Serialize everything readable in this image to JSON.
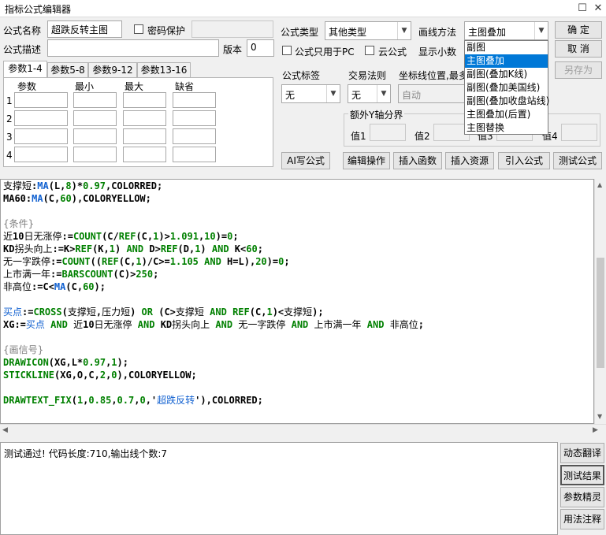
{
  "window": {
    "title": "指标公式编辑器",
    "restore_glyph": "☐",
    "close_glyph": "✕"
  },
  "form": {
    "name_label": "公式名称",
    "name_value": "超跌反转主图",
    "password_label": "密码保护",
    "desc_label": "公式描述",
    "version_label": "版本",
    "version_value": "0",
    "type_label": "公式类型",
    "type_value": "其他类型",
    "draw_label": "画线方法",
    "draw_value": "主图叠加",
    "pc_only_label": "公式只用于PC",
    "cloud_label": "云公式",
    "decimals_label": "显示小数",
    "tag_label": "公式标签",
    "tag_value": "无",
    "trade_label": "交易法则",
    "trade_value": "无",
    "axis_label": "坐标线位置,最多",
    "axis_value": "自动",
    "y_axis_group": "额外Y轴分界",
    "y_values": [
      "值1",
      "值2",
      "值3",
      "值4"
    ]
  },
  "buttons": {
    "ok": "确 定",
    "cancel": "取 消",
    "save_as": "另存为",
    "ai_write": "AI写公式",
    "edit_ops": "编辑操作",
    "insert_func": "插入函数",
    "insert_res": "插入资源",
    "import_formula": "引入公式",
    "test_formula": "测试公式"
  },
  "param_tabs": [
    "参数1-4",
    "参数5-8",
    "参数9-12",
    "参数13-16"
  ],
  "param_headers": [
    "参数",
    "最小",
    "最大",
    "缺省"
  ],
  "param_rows": [
    "1",
    "2",
    "3",
    "4"
  ],
  "dropdown_options": [
    "副图",
    "主图叠加",
    "副图(叠加K线)",
    "副图(叠加美国线)",
    "副图(叠加收盘站线)",
    "主图叠加(后置)",
    "主图替换"
  ],
  "dropdown_selected": 1,
  "status": {
    "message": "测试通过! 代码长度:710,输出线个数:7"
  },
  "side_buttons": [
    "动态翻译",
    "测试结果",
    "参数精灵",
    "用法注释"
  ]
}
